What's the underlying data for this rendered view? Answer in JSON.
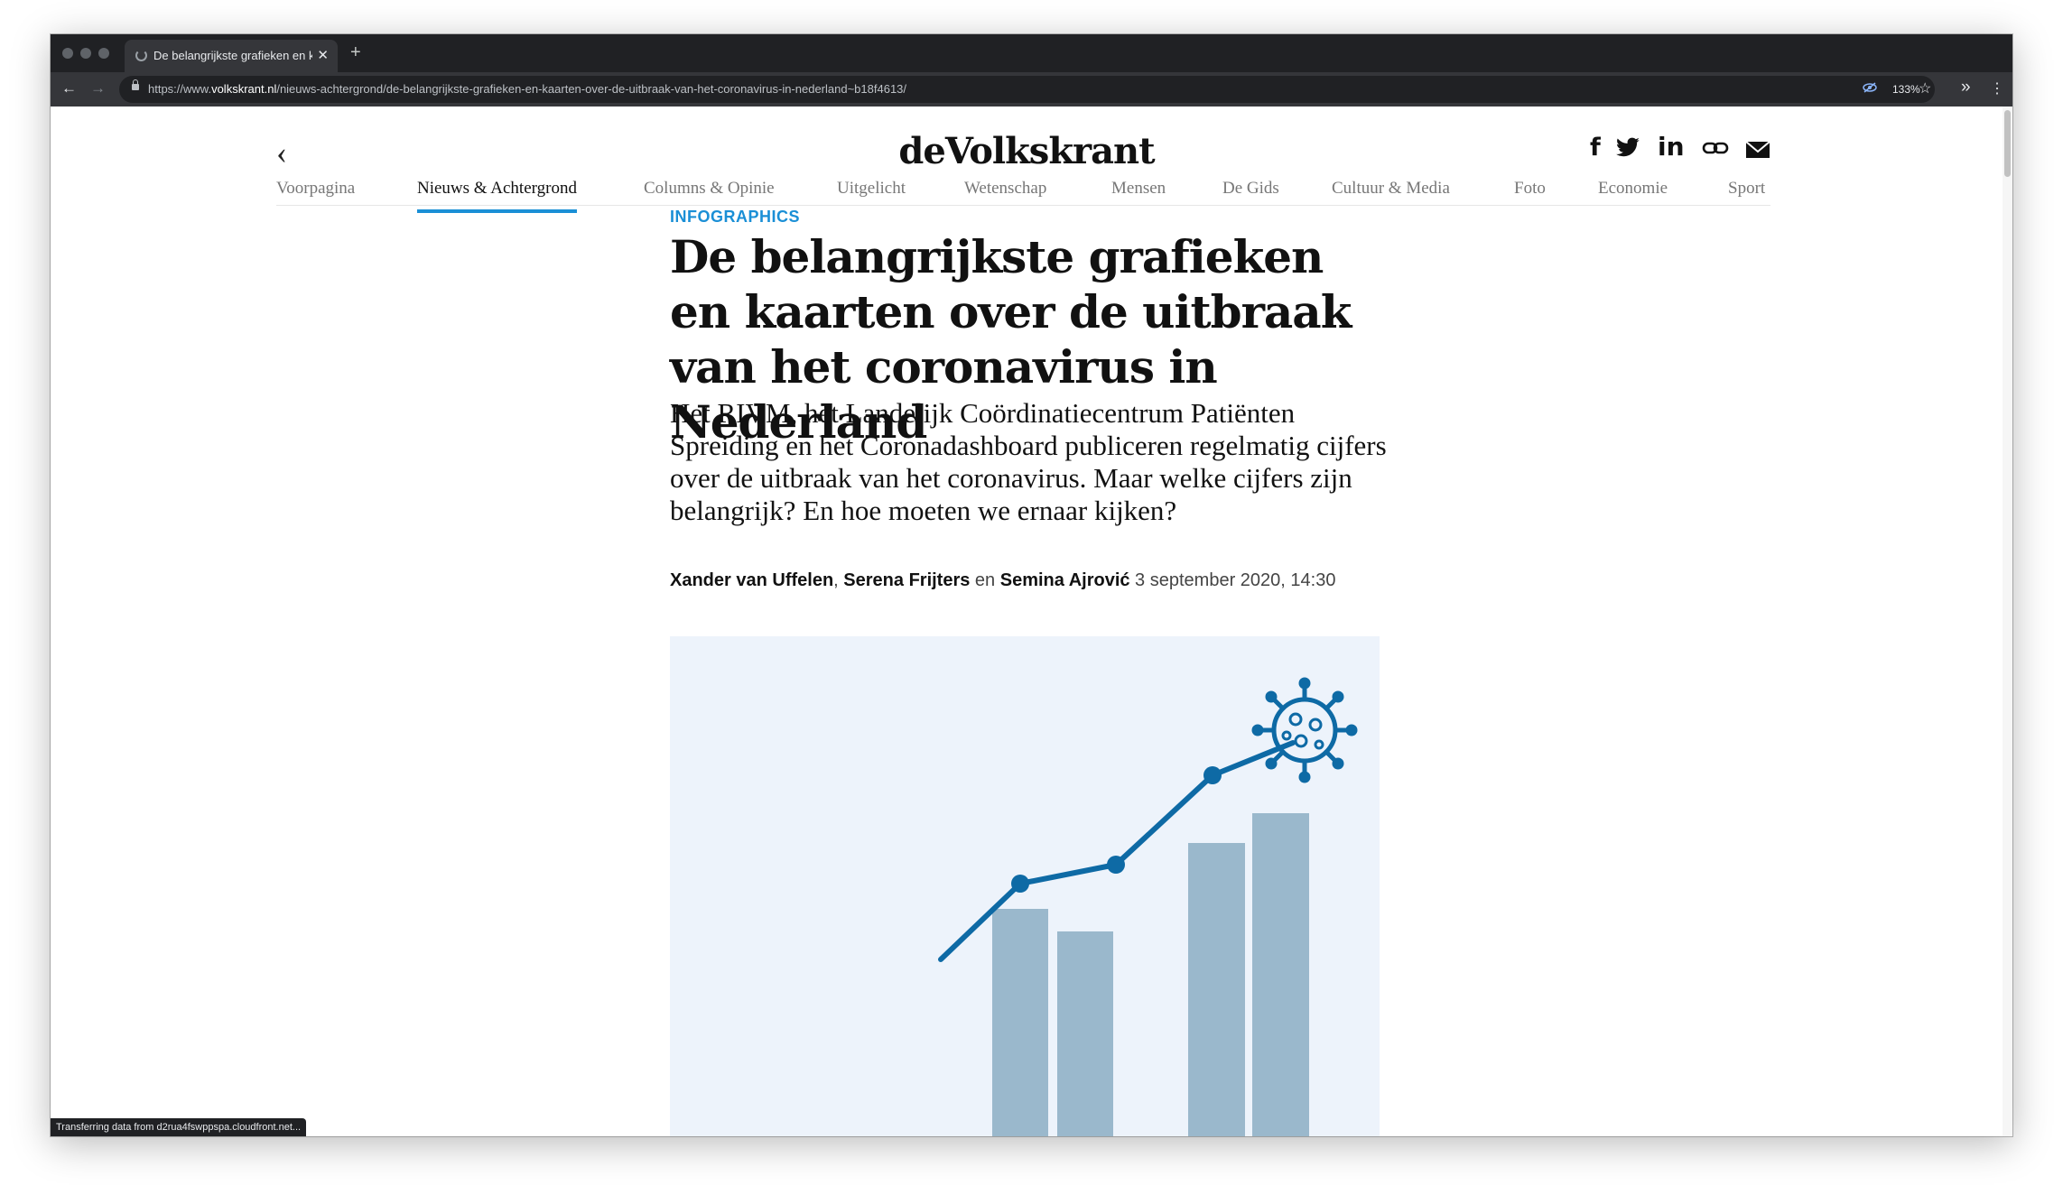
{
  "browser": {
    "tab_title": "De belangrijkste grafieken en k",
    "url_prefix": "https://www.",
    "url_domain": "volkskrant.nl",
    "url_path": "/nieuws-achtergrond/de-belangrijkste-grafieken-en-kaarten-over-de-uitbraak-van-het-coronavirus-in-nederland~b18f4613/",
    "zoom": "133%",
    "status": "Transferring data from d2rua4fswppspa.cloudfront.net..."
  },
  "site": {
    "logo": "deVolkskrant",
    "share_icons": [
      "facebook-icon",
      "twitter-icon",
      "linkedin-icon",
      "link-icon",
      "mail-icon"
    ]
  },
  "nav": {
    "items": [
      {
        "label": "Voorpagina"
      },
      {
        "label": "Nieuws & Achtergrond",
        "active": true
      },
      {
        "label": "Columns & Opinie"
      },
      {
        "label": "Uitgelicht"
      },
      {
        "label": "Wetenschap"
      },
      {
        "label": "Mensen"
      },
      {
        "label": "De Gids"
      },
      {
        "label": "Cultuur & Media"
      },
      {
        "label": "Foto"
      },
      {
        "label": "Economie"
      },
      {
        "label": "Sport"
      }
    ]
  },
  "article": {
    "kicker": "INFOGRAPHICS",
    "headline": "De belangrijkste grafieken en kaarten over de uitbraak van het coronavirus in Nederland",
    "lead": "Het RIVM, het Landelijk Coördinatiecentrum Patiënten Spreiding en het Coronadashboard publiceren regelmatig cijfers over de uitbraak van het coronavirus. Maar welke cijfers zijn belangrijk? En hoe moeten we ernaar kijken?",
    "authors": [
      "Xander van Uffelen",
      "Serena Frijters",
      "Semina Ajrović"
    ],
    "separator_comma": ", ",
    "separator_and": " en ",
    "date": " 3 september 2020, 14:30"
  },
  "colors": {
    "accent": "#1a8fd6",
    "figure_bg": "#edf3fb",
    "line": "#0e6aa5",
    "bars": "#9ab8cc"
  }
}
